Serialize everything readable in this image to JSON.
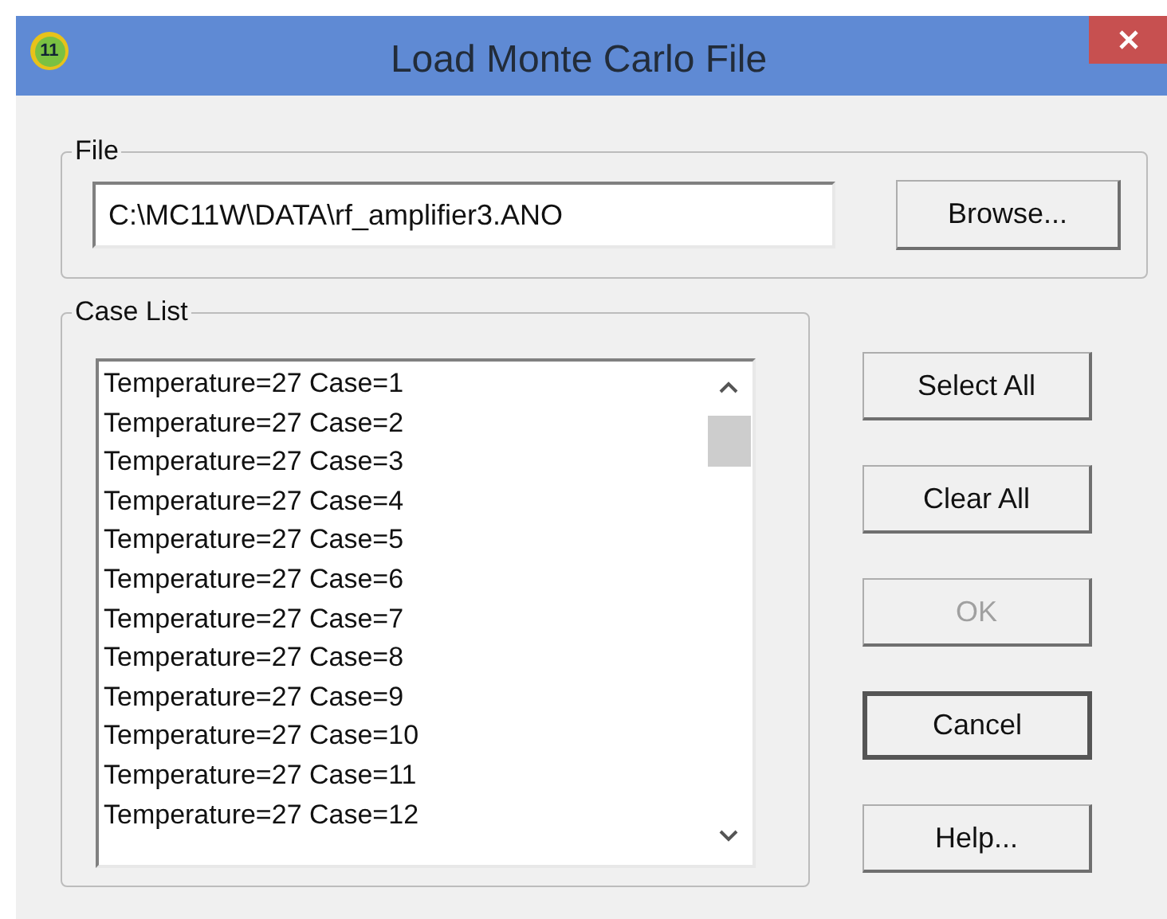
{
  "window": {
    "title": "Load Monte Carlo File",
    "app_badge": "11"
  },
  "file_group": {
    "label": "File",
    "path": "C:\\MC11W\\DATA\\rf_amplifier3.ANO",
    "browse_button": "Browse..."
  },
  "case_list": {
    "label": "Case List",
    "items": [
      "Temperature=27 Case=1",
      "Temperature=27 Case=2",
      "Temperature=27 Case=3",
      "Temperature=27 Case=4",
      "Temperature=27 Case=5",
      "Temperature=27 Case=6",
      "Temperature=27 Case=7",
      "Temperature=27 Case=8",
      "Temperature=27 Case=9",
      "Temperature=27 Case=10",
      "Temperature=27 Case=11",
      "Temperature=27 Case=12"
    ]
  },
  "buttons": [
    {
      "label": "Select All",
      "disabled": false,
      "default": false
    },
    {
      "label": "Clear All",
      "disabled": false,
      "default": false
    },
    {
      "label": "OK",
      "disabled": true,
      "default": false
    },
    {
      "label": "Cancel",
      "disabled": false,
      "default": true
    },
    {
      "label": "Help...",
      "disabled": false,
      "default": false
    }
  ]
}
